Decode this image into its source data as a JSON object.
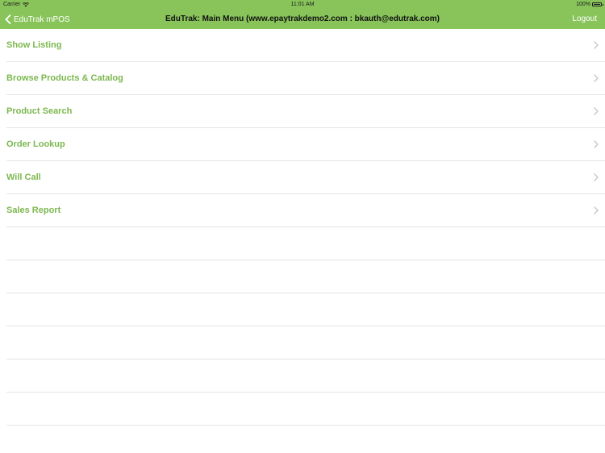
{
  "status_bar": {
    "carrier": "Carrier",
    "time": "11:01 AM",
    "battery": "100%"
  },
  "nav": {
    "back_label": "EduTrak mPOS",
    "title": "EduTrak: Main Menu (www.epaytrakdemo2.com : bkauth@edutrak.com)",
    "logout_label": "Logout"
  },
  "menu": {
    "items": [
      {
        "label": "Show Listing"
      },
      {
        "label": "Browse Products & Catalog"
      },
      {
        "label": "Product Search"
      },
      {
        "label": "Order Lookup"
      },
      {
        "label": "Will Call"
      },
      {
        "label": "Sales Report"
      }
    ]
  },
  "colors": {
    "accent": "#88c45a",
    "item_text": "#7cb84f",
    "separator": "#e3e3e3",
    "chevron": "#c7c7cc"
  },
  "icons": {
    "back": "chevron-left-icon",
    "row": "chevron-right-icon",
    "wifi": "wifi-icon",
    "battery": "battery-icon"
  }
}
